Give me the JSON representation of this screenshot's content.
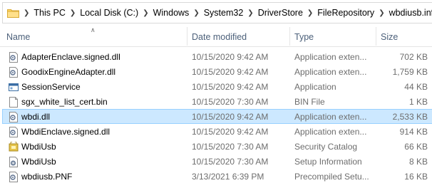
{
  "address_bar": {
    "breadcrumbs": [
      "This PC",
      "Local Disk (C:)",
      "Windows",
      "System32",
      "DriverStore",
      "FileRepository",
      "wbdiusb.inf_am"
    ]
  },
  "columns": {
    "name": "Name",
    "date_modified": "Date modified",
    "type": "Type",
    "size": "Size"
  },
  "files": [
    {
      "name": "AdapterEnclave.signed.dll",
      "date": "10/15/2020 9:42 AM",
      "type": "Application exten...",
      "size": "702 KB",
      "icon": "dll-icon"
    },
    {
      "name": "GoodixEngineAdapter.dll",
      "date": "10/15/2020 9:42 AM",
      "type": "Application exten...",
      "size": "1,759 KB",
      "icon": "dll-icon"
    },
    {
      "name": "SessionService",
      "date": "10/15/2020 9:42 AM",
      "type": "Application",
      "size": "44 KB",
      "icon": "application-icon"
    },
    {
      "name": "sgx_white_list_cert.bin",
      "date": "10/15/2020 7:30 AM",
      "type": "BIN File",
      "size": "1 KB",
      "icon": "blank-file-icon"
    },
    {
      "name": "wbdi.dll",
      "date": "10/15/2020 9:42 AM",
      "type": "Application exten...",
      "size": "2,533 KB",
      "icon": "dll-icon",
      "selected": true
    },
    {
      "name": "WbdiEnclave.signed.dll",
      "date": "10/15/2020 9:42 AM",
      "type": "Application exten...",
      "size": "914 KB",
      "icon": "dll-icon"
    },
    {
      "name": "WbdiUsb",
      "date": "10/15/2020 7:30 AM",
      "type": "Security Catalog",
      "size": "66 KB",
      "icon": "security-catalog-icon"
    },
    {
      "name": "WbdiUsb",
      "date": "10/15/2020 7:30 AM",
      "type": "Setup Information",
      "size": "8 KB",
      "icon": "setup-information-icon"
    },
    {
      "name": "wbdiusb.PNF",
      "date": "3/13/2021 6:39 PM",
      "type": "Precompiled Setu...",
      "size": "16 KB",
      "icon": "pnf-file-icon"
    }
  ]
}
